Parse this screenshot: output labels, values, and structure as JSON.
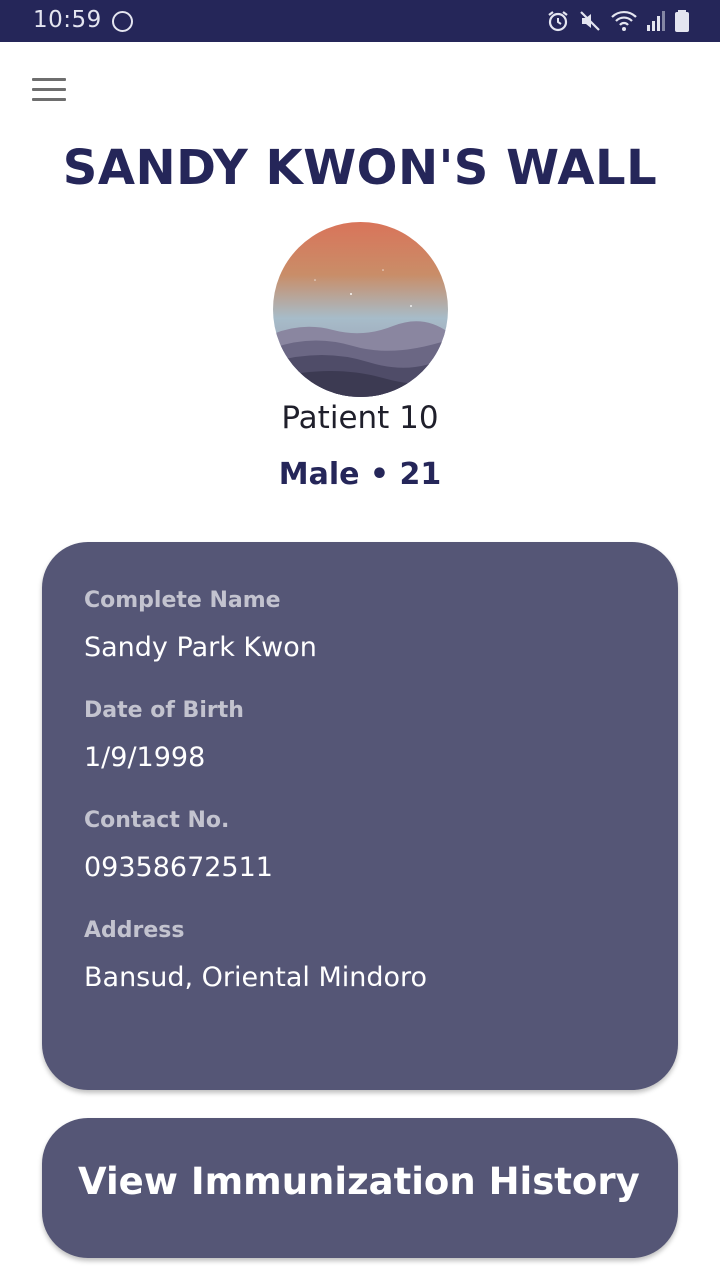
{
  "status_bar": {
    "time": "10:59",
    "icons": [
      "circle-notification-icon",
      "alarm-icon",
      "mute-icon",
      "wifi-icon",
      "signal-icon",
      "battery-icon"
    ]
  },
  "header": {
    "menu_icon": "hamburger-menu-icon",
    "title": "SANDY KWON'S WALL"
  },
  "profile": {
    "name": "Patient 10",
    "sub": "Male • 21"
  },
  "details": {
    "fields": [
      {
        "label": "Complete Name",
        "value": "Sandy Park Kwon"
      },
      {
        "label": "Date of Birth",
        "value": "1/9/1998"
      },
      {
        "label": "Contact No.",
        "value": "09358672511"
      },
      {
        "label": "Address",
        "value": "Bansud, Oriental Mindoro"
      }
    ]
  },
  "actions": {
    "history_label": "View Immunization History"
  },
  "colors": {
    "primary": "#252659",
    "card": "#555676",
    "label": "#c3c3cf",
    "value": "#ffffff"
  }
}
